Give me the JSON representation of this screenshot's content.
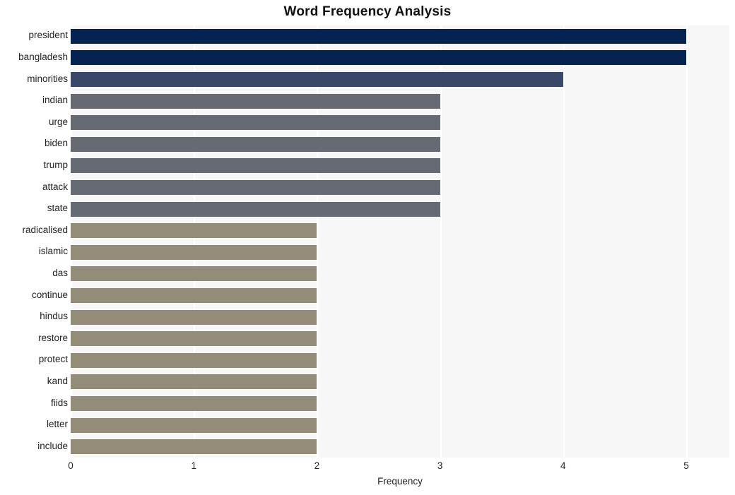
{
  "chart_data": {
    "type": "bar",
    "orientation": "horizontal",
    "title": "Word Frequency Analysis",
    "xlabel": "Frequency",
    "ylabel": "",
    "xlim": [
      0,
      5.35
    ],
    "ylim": [
      0,
      20
    ],
    "xticks": [
      "0",
      "1",
      "2",
      "3",
      "4",
      "5"
    ],
    "xtick_values": [
      0,
      1,
      2,
      3,
      4,
      5
    ],
    "grid": "vertical-white-on-light",
    "legend": "none",
    "categories": [
      "president",
      "bangladesh",
      "minorities",
      "indian",
      "urge",
      "biden",
      "trump",
      "attack",
      "state",
      "radicalised",
      "islamic",
      "das",
      "continue",
      "hindus",
      "restore",
      "protect",
      "kand",
      "fiids",
      "letter",
      "include"
    ],
    "values": [
      5,
      5,
      4,
      3,
      3,
      3,
      3,
      3,
      3,
      2,
      2,
      2,
      2,
      2,
      2,
      2,
      2,
      2,
      2,
      2
    ],
    "bar_colors": [
      "#042350",
      "#042350",
      "#394768",
      "#666a73",
      "#666a73",
      "#666a73",
      "#666a73",
      "#666a73",
      "#666a73",
      "#928c78",
      "#928c78",
      "#928c78",
      "#928c78",
      "#928c78",
      "#928c78",
      "#928c78",
      "#928c78",
      "#928c78",
      "#928c78",
      "#928c78"
    ]
  },
  "style": {
    "plot_background": "#f7f7f7",
    "figure_background": "#ffffff",
    "gridline_color": "#ffffff",
    "text_color": "#222222",
    "title_color": "#111111"
  }
}
